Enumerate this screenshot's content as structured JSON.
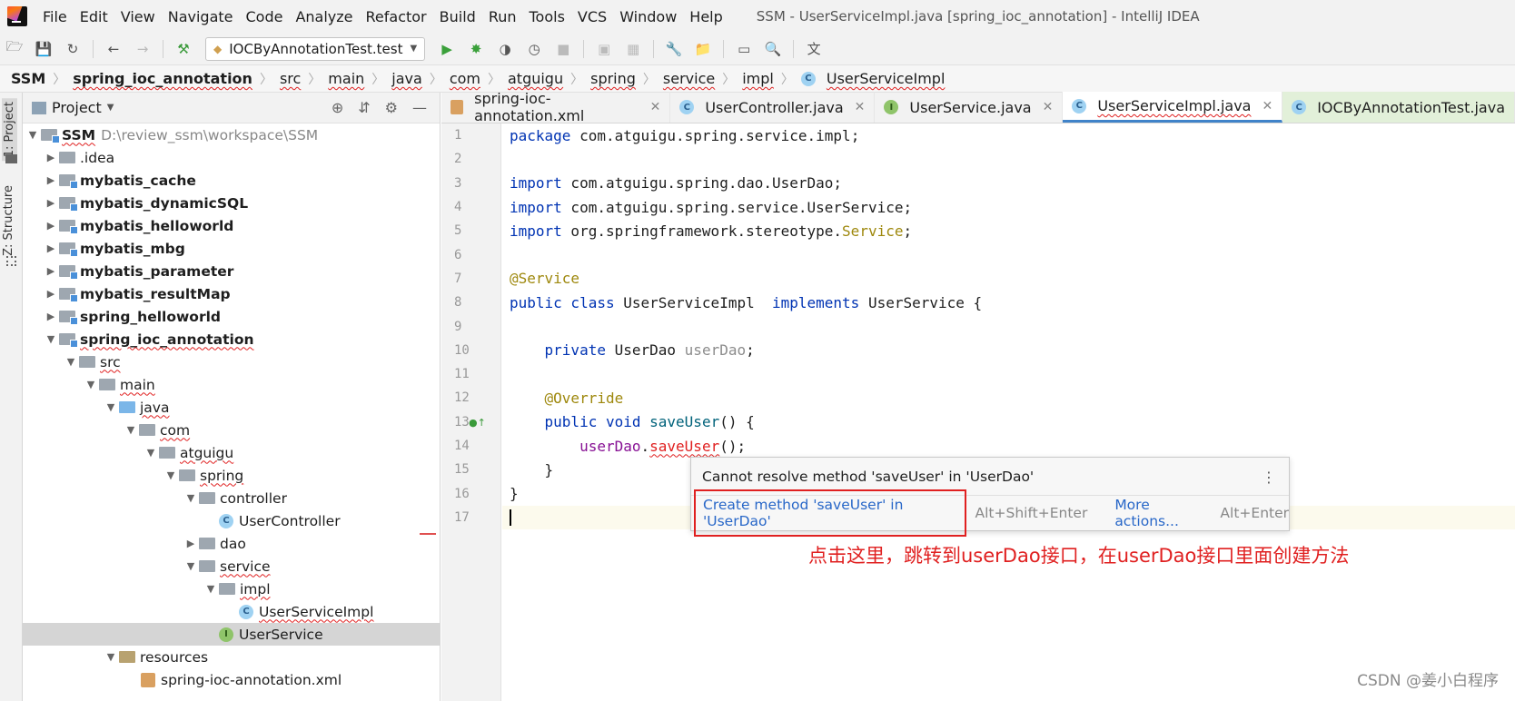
{
  "menubar": {
    "items": [
      "File",
      "Edit",
      "View",
      "Navigate",
      "Code",
      "Analyze",
      "Refactor",
      "Build",
      "Run",
      "Tools",
      "VCS",
      "Window",
      "Help"
    ],
    "window_title": "SSM - UserServiceImpl.java [spring_ioc_annotation] - IntelliJ IDEA"
  },
  "toolbar": {
    "run_config": "IOCByAnnotationTest.test"
  },
  "breadcrumb": [
    "SSM",
    "spring_ioc_annotation",
    "src",
    "main",
    "java",
    "com",
    "atguigu",
    "spring",
    "service",
    "impl",
    "UserServiceImpl"
  ],
  "leftstrip": {
    "project_tab": "1: Project",
    "structure_tab": "Z: Structure"
  },
  "project_panel": {
    "title": "Project",
    "root_name": "SSM",
    "root_path": "D:\\review_ssm\\workspace\\SSM",
    "items": [
      {
        "label": ".idea"
      },
      {
        "label": "mybatis_cache"
      },
      {
        "label": "mybatis_dynamicSQL"
      },
      {
        "label": "mybatis_helloworld"
      },
      {
        "label": "mybatis_mbg"
      },
      {
        "label": "mybatis_parameter"
      },
      {
        "label": "mybatis_resultMap"
      },
      {
        "label": "spring_helloworld"
      },
      {
        "label": "spring_ioc_annotation"
      },
      {
        "label": "src"
      },
      {
        "label": "main"
      },
      {
        "label": "java"
      },
      {
        "label": "com"
      },
      {
        "label": "atguigu"
      },
      {
        "label": "spring"
      },
      {
        "label": "controller"
      },
      {
        "label": "UserController"
      },
      {
        "label": "dao"
      },
      {
        "label": "service"
      },
      {
        "label": "impl"
      },
      {
        "label": "UserServiceImpl"
      },
      {
        "label": "UserService"
      },
      {
        "label": "resources"
      },
      {
        "label": "spring-ioc-annotation.xml"
      }
    ]
  },
  "editor_tabs": [
    "spring-ioc-annotation.xml",
    "UserController.java",
    "UserService.java",
    "UserServiceImpl.java",
    "IOCByAnnotationTest.java"
  ],
  "code": {
    "line_numbers": [
      "1",
      "2",
      "3",
      "4",
      "5",
      "6",
      "7",
      "8",
      "9",
      "10",
      "11",
      "12",
      "13",
      "14",
      "15",
      "16",
      "17"
    ],
    "l1_kw": "package",
    "l1_rest": " com.atguigu.spring.service.impl;",
    "l3_kw": "import",
    "l3_rest": " com.atguigu.spring.dao.UserDao;",
    "l4_kw": "import",
    "l4_rest": " com.atguigu.spring.service.UserService;",
    "l5_kw": "import",
    "l5_rest": " org.springframework.stereotype.",
    "l5_cls": "Service",
    "l5_end": ";",
    "l7_ann": "@Service",
    "l8_kw1": "public class",
    "l8_name": " UserServiceImpl  ",
    "l8_kw2": "implements",
    "l8_rest": " UserService {",
    "l10_kw": "    private",
    "l10_type": " UserDao ",
    "l10_field": "userDao",
    "l10_end": ";",
    "l12_ann": "    @Override",
    "l13_kw": "    public void",
    "l13_sp": " ",
    "l13_m": "saveUser",
    "l13_rest": "() {",
    "l14_ind": "        ",
    "l14_field": "userDao",
    "l14_dot": ".",
    "l14_m": "saveUser",
    "l14_rest": "();",
    "l15": "    }",
    "l16": "}"
  },
  "popup": {
    "message": "Cannot resolve method 'saveUser' in 'UserDao'",
    "primary_action": "Create method 'saveUser' in 'UserDao'",
    "primary_shortcut": "Alt+Shift+Enter",
    "more_actions": "More actions...",
    "more_shortcut": "Alt+Enter"
  },
  "annotation_text": "点击这里，跳转到userDao接口，在userDao接口里面创建方法",
  "watermark": "CSDN @姜小白程序"
}
